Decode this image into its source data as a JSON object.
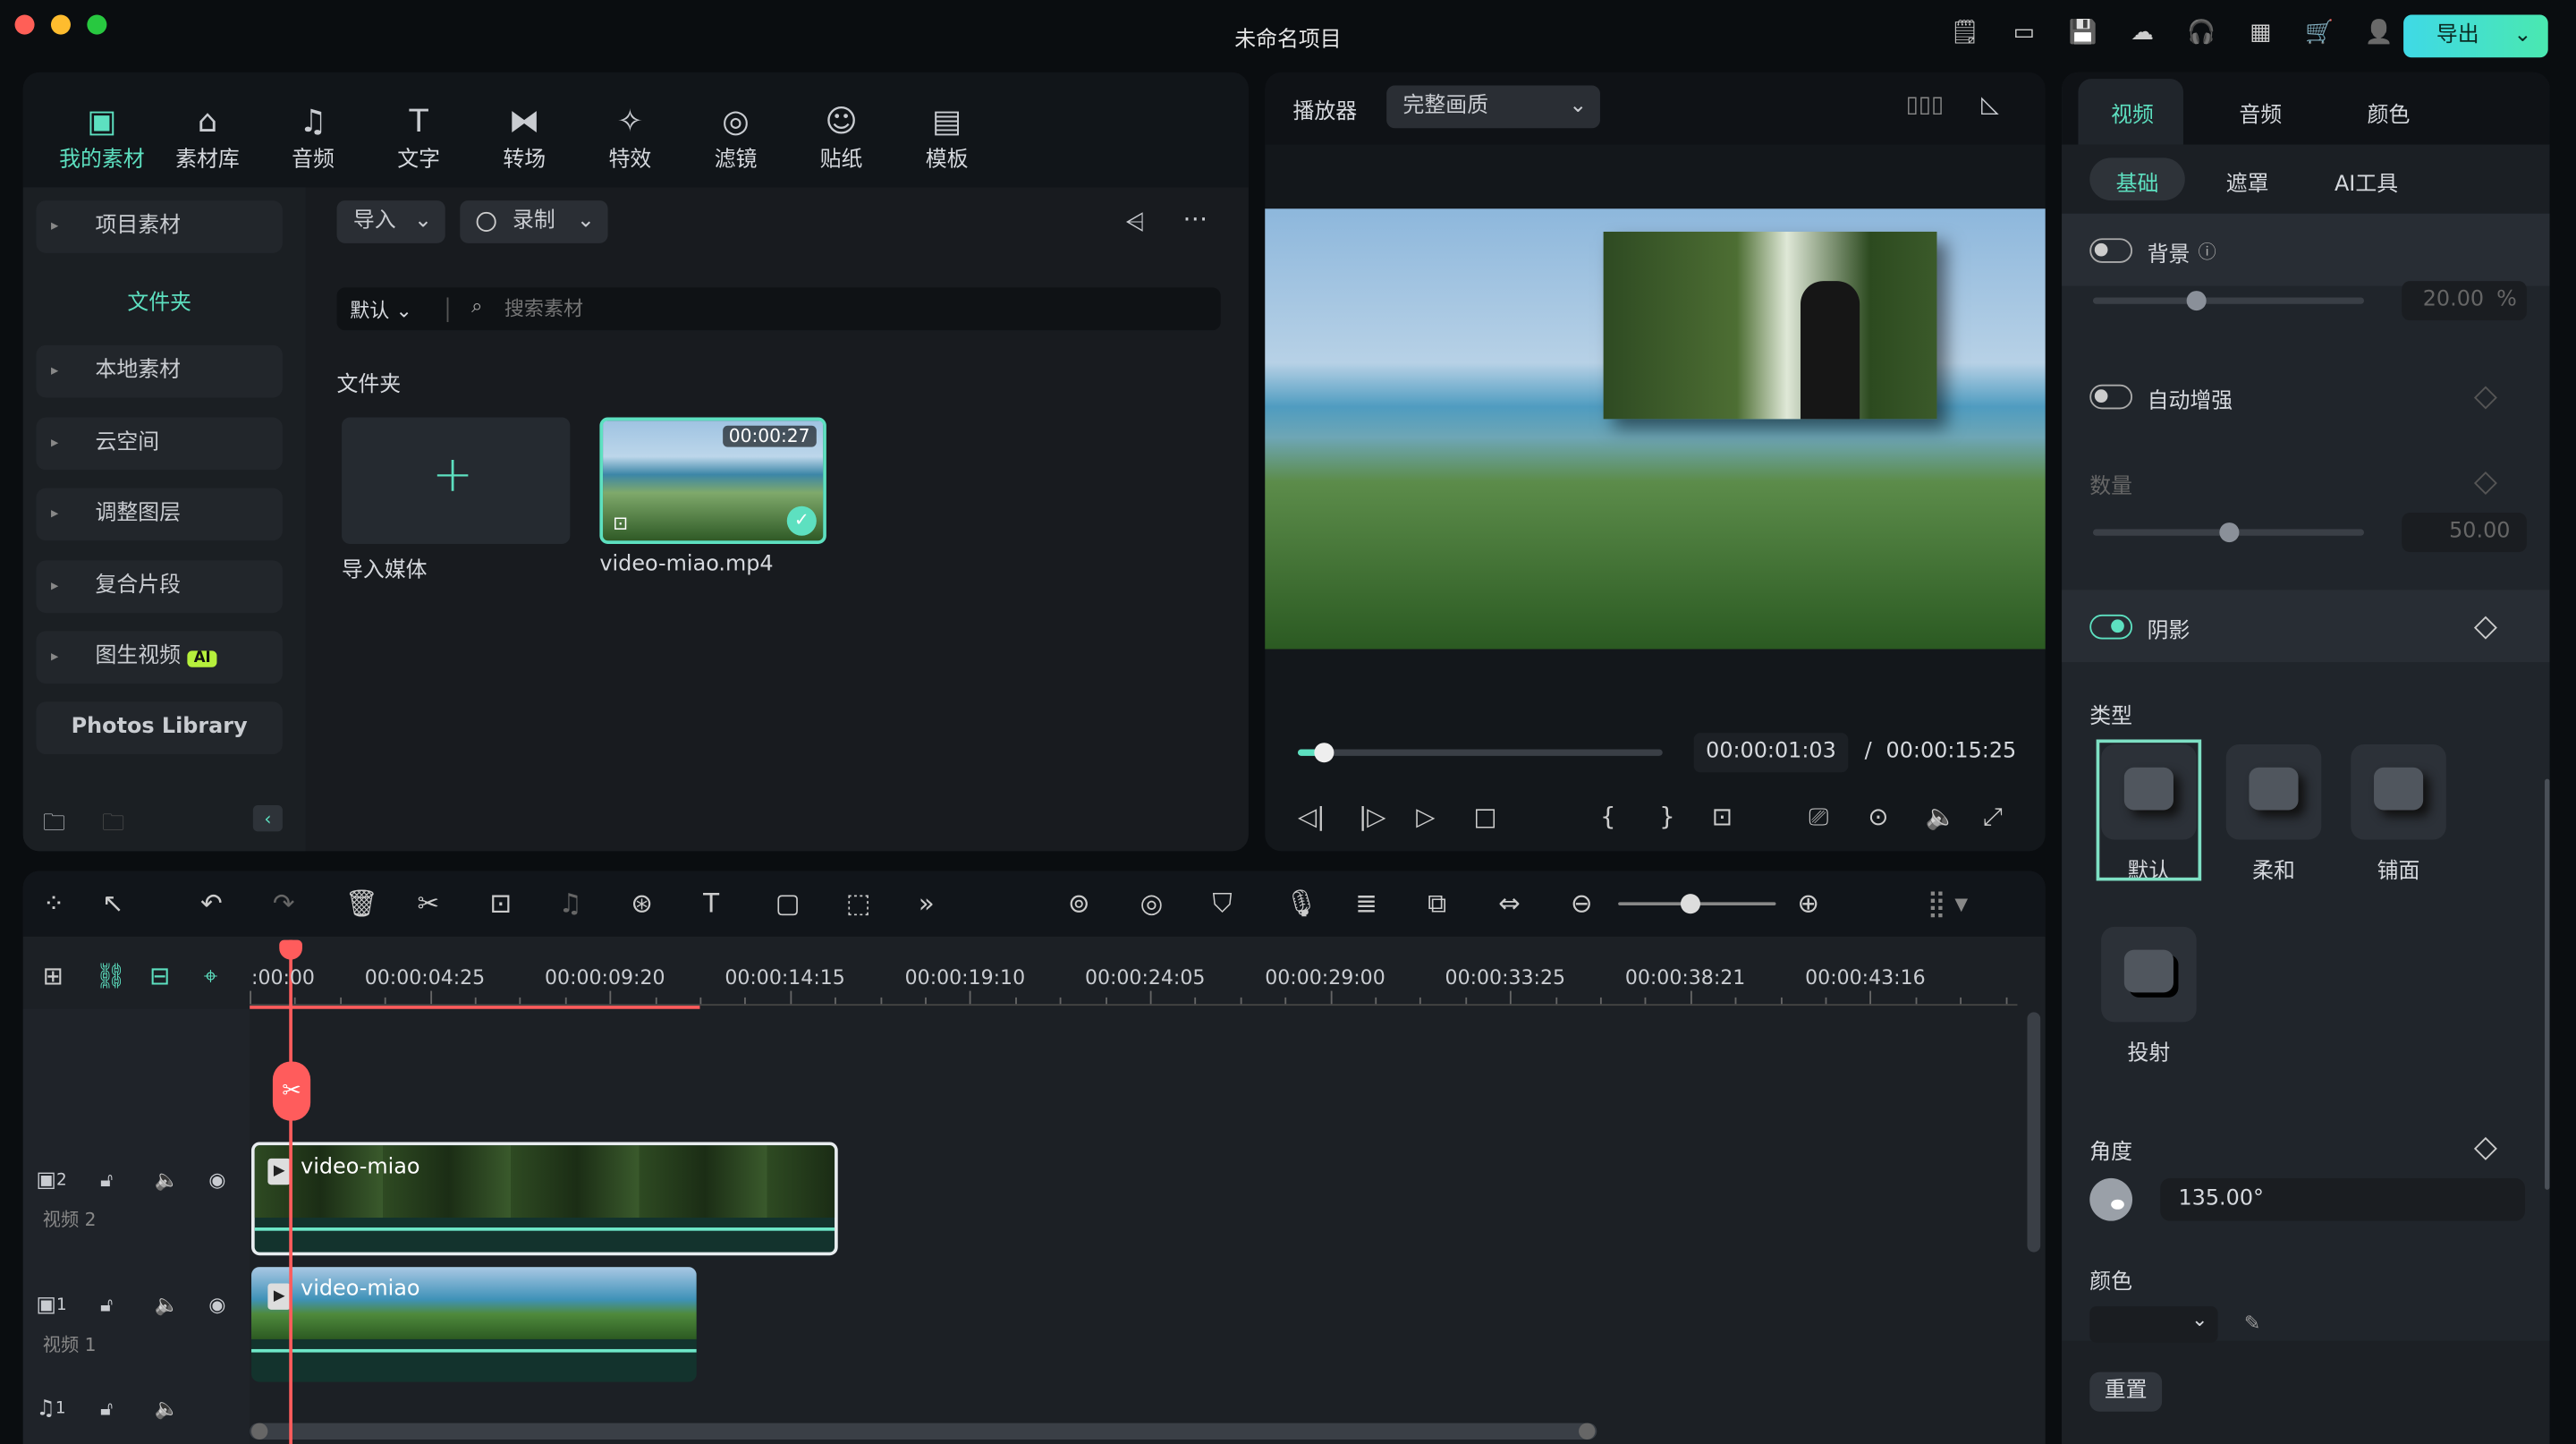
{
  "window": {
    "title": "未命名项目",
    "export_label": "导出"
  },
  "colors": {
    "accent": "#5de0c0",
    "playhead": "#ff5c5c",
    "bg": "#0a0d10",
    "panel": "#1b1f24"
  },
  "title_icons": [
    "notes-icon",
    "layout-icon",
    "save-icon",
    "cloud-icon",
    "headset-icon",
    "apps-icon",
    "cart-icon",
    "user-icon"
  ],
  "media_tabs": [
    {
      "label": "我的素材",
      "icon": "my-media-icon",
      "active": true
    },
    {
      "label": "素材库",
      "icon": "stock-icon"
    },
    {
      "label": "音频",
      "icon": "music-icon"
    },
    {
      "label": "文字",
      "icon": "text-icon"
    },
    {
      "label": "转场",
      "icon": "transition-icon"
    },
    {
      "label": "特效",
      "icon": "effects-icon"
    },
    {
      "label": "滤镜",
      "icon": "filter-icon"
    },
    {
      "label": "贴纸",
      "icon": "sticker-icon"
    },
    {
      "label": "模板",
      "icon": "template-icon"
    }
  ],
  "sidebar": {
    "project": "项目素材",
    "folder": "文件夹",
    "items": [
      "本地素材",
      "云空间",
      "调整图层",
      "复合片段",
      "图生视频"
    ],
    "ai_badge": "AI",
    "photos": "Photos Library"
  },
  "media": {
    "import": "导入",
    "record": "录制",
    "sort": "默认",
    "search_placeholder": "搜索素材",
    "section": "文件夹",
    "import_media": "导入媒体",
    "file_name": "video-miao.mp4",
    "file_duration": "00:00:27"
  },
  "player": {
    "label": "播放器",
    "quality": "完整画质",
    "current": "00:00:01:03",
    "sep": "/",
    "total": "00:00:15:25",
    "progress": 0.07
  },
  "props": {
    "tabs": [
      "视频",
      "音频",
      "颜色"
    ],
    "subtabs": [
      "基础",
      "遮罩",
      "AI工具"
    ],
    "background": {
      "label": "背景",
      "value": "20.00",
      "unit": "%",
      "enabled": false,
      "level": 0.2
    },
    "auto_enhance": {
      "label": "自动增强",
      "enabled": false
    },
    "amount": {
      "label": "数量",
      "value": "50.00",
      "level": 0.5
    },
    "shadow": {
      "label": "阴影",
      "enabled": true
    },
    "type_label": "类型",
    "types": [
      "默认",
      "柔和",
      "铺面",
      "投射"
    ],
    "selected_type": "默认",
    "angle": {
      "label": "角度",
      "value": "135.00°"
    },
    "color_label": "颜色",
    "reset": "重置"
  },
  "timeline": {
    "ticks": [
      ":00:00",
      "00:00:04:25",
      "00:00:09:20",
      "00:00:14:15",
      "00:00:19:10",
      "00:00:24:05",
      "00:00:29:00",
      "00:00:33:25",
      "00:00:38:21",
      "00:00:43:16"
    ],
    "tracks": [
      {
        "num": "2",
        "name": "视频 2",
        "clip": "video-miao"
      },
      {
        "num": "1",
        "name": "视频 1",
        "clip": "video-miao"
      },
      {
        "num": "1"
      }
    ],
    "zoom_level": 0.46
  }
}
